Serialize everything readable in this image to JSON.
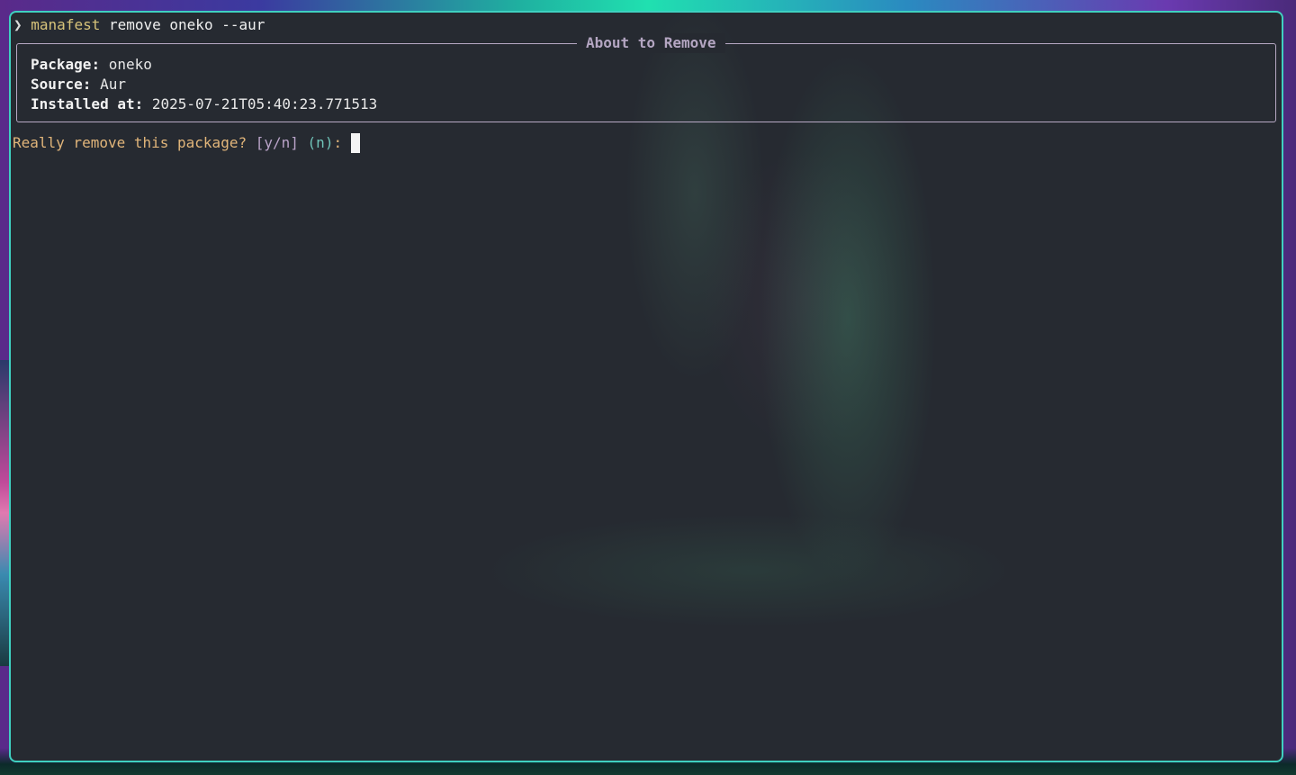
{
  "terminal": {
    "prompt_symbol": "❯",
    "command_name": "manafest",
    "command_args": " remove oneko --aur"
  },
  "panel": {
    "title": "About to Remove",
    "fields": [
      {
        "key": "Package",
        "value": "oneko"
      },
      {
        "key": "Source",
        "value": "Aur"
      },
      {
        "key": "Installed at",
        "value": "2025-07-21T05:40:23.771513"
      }
    ]
  },
  "confirm": {
    "question": "Really remove this package?",
    "choices": "[y/n]",
    "default": "(n)",
    "colon": ":"
  },
  "colors": {
    "border": "#3fd0c0",
    "command": "#d7c37a",
    "question": "#e1b57a",
    "choices": "#b9a3c8",
    "default": "#6fc3b8",
    "panel_title": "#b4a6c2"
  }
}
